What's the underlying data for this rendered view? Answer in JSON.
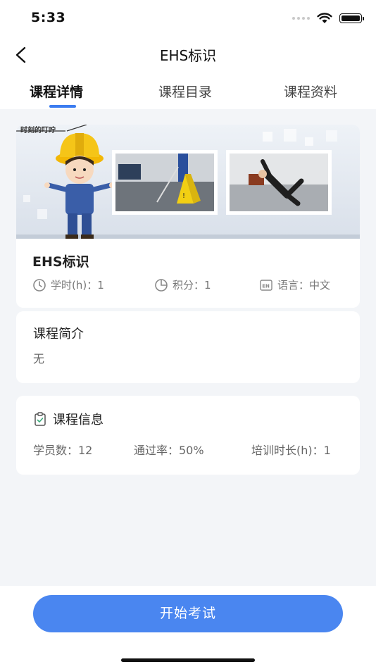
{
  "status_bar": {
    "time": "5:33"
  },
  "header": {
    "title": "EHS标识"
  },
  "tabs": [
    {
      "label": "课程详情",
      "active": true
    },
    {
      "label": "课程目录",
      "active": false
    },
    {
      "label": "课程资料",
      "active": false
    }
  ],
  "banner": {
    "caption": "时刻的叮咛"
  },
  "course": {
    "name": "EHS标识",
    "hours": "学时(h)：1",
    "points": "积分：1",
    "language_badge": "EN",
    "language": "语言：中文"
  },
  "intro": {
    "title": "课程简介",
    "text": "无"
  },
  "info": {
    "title": "课程信息",
    "students": "学员数：12",
    "pass_rate": "通过率：50%",
    "training_hours": "培训时长(h)：1"
  },
  "actions": {
    "start_exam": "开始考试"
  },
  "colors": {
    "accent": "#4a86f0",
    "background": "#f3f5f8"
  }
}
